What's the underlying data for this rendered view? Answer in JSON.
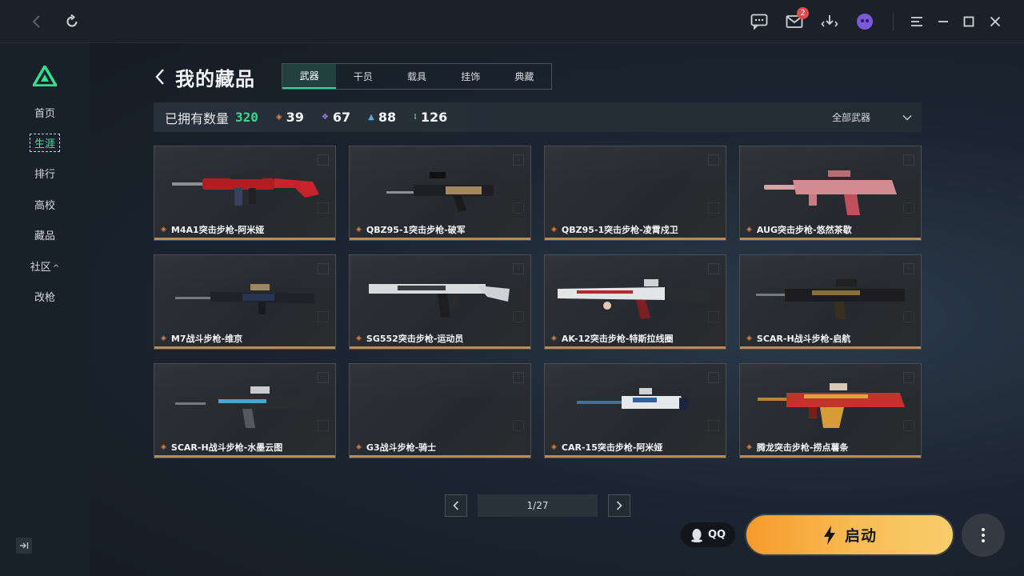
{
  "sidebar": {
    "items": [
      {
        "label": "首页"
      },
      {
        "label": "生涯"
      },
      {
        "label": "排行"
      },
      {
        "label": "高校"
      },
      {
        "label": "藏品"
      },
      {
        "label": "社区"
      },
      {
        "label": "改枪"
      }
    ],
    "community_caret": "^",
    "active_index": 1
  },
  "topbar": {
    "mail_badge": "2"
  },
  "page": {
    "title": "我的藏品",
    "tabs": [
      "武器",
      "干员",
      "载具",
      "挂饰",
      "典藏"
    ],
    "active_tab": 0
  },
  "stats": {
    "owned_label": "已拥有数量",
    "owned_total": "320",
    "groups": [
      {
        "count": "39",
        "color": "#e0884a"
      },
      {
        "count": "67",
        "color": "#a77be8"
      },
      {
        "count": "88",
        "color": "#5aa7e6"
      },
      {
        "count": "126",
        "color": "#3ccb97"
      }
    ],
    "filter_label": "全部武器"
  },
  "items": [
    {
      "name": "M4A1突击步枪-阿米娅",
      "skin": "red"
    },
    {
      "name": "QBZ95-1突击步枪-破军",
      "skin": "black-gold"
    },
    {
      "name": "QBZ95-1突击步枪-凌霄戍卫",
      "skin": "none"
    },
    {
      "name": "AUG突击步枪-悠然茶歇",
      "skin": "pink"
    },
    {
      "name": "M7战斗步枪-维京",
      "skin": "dark"
    },
    {
      "name": "SG552突击步枪-运动员",
      "skin": "white"
    },
    {
      "name": "AK-12突击步枪-特斯拉线圈",
      "skin": "white-red"
    },
    {
      "name": "SCAR-H战斗步枪-启航",
      "skin": "black-gold"
    },
    {
      "name": "SCAR-H战斗步枪-水墨云图",
      "skin": "dark-blue"
    },
    {
      "name": "G3战斗步枪-骑士",
      "skin": "none"
    },
    {
      "name": "CAR-15突击步枪-阿米娅",
      "skin": "blue-white"
    },
    {
      "name": "腾龙突击步枪-捞点薯条",
      "skin": "red-gold"
    }
  ],
  "pager": {
    "text": "1/27"
  },
  "footer": {
    "qq_label": "QQ",
    "launch_label": "启动"
  }
}
